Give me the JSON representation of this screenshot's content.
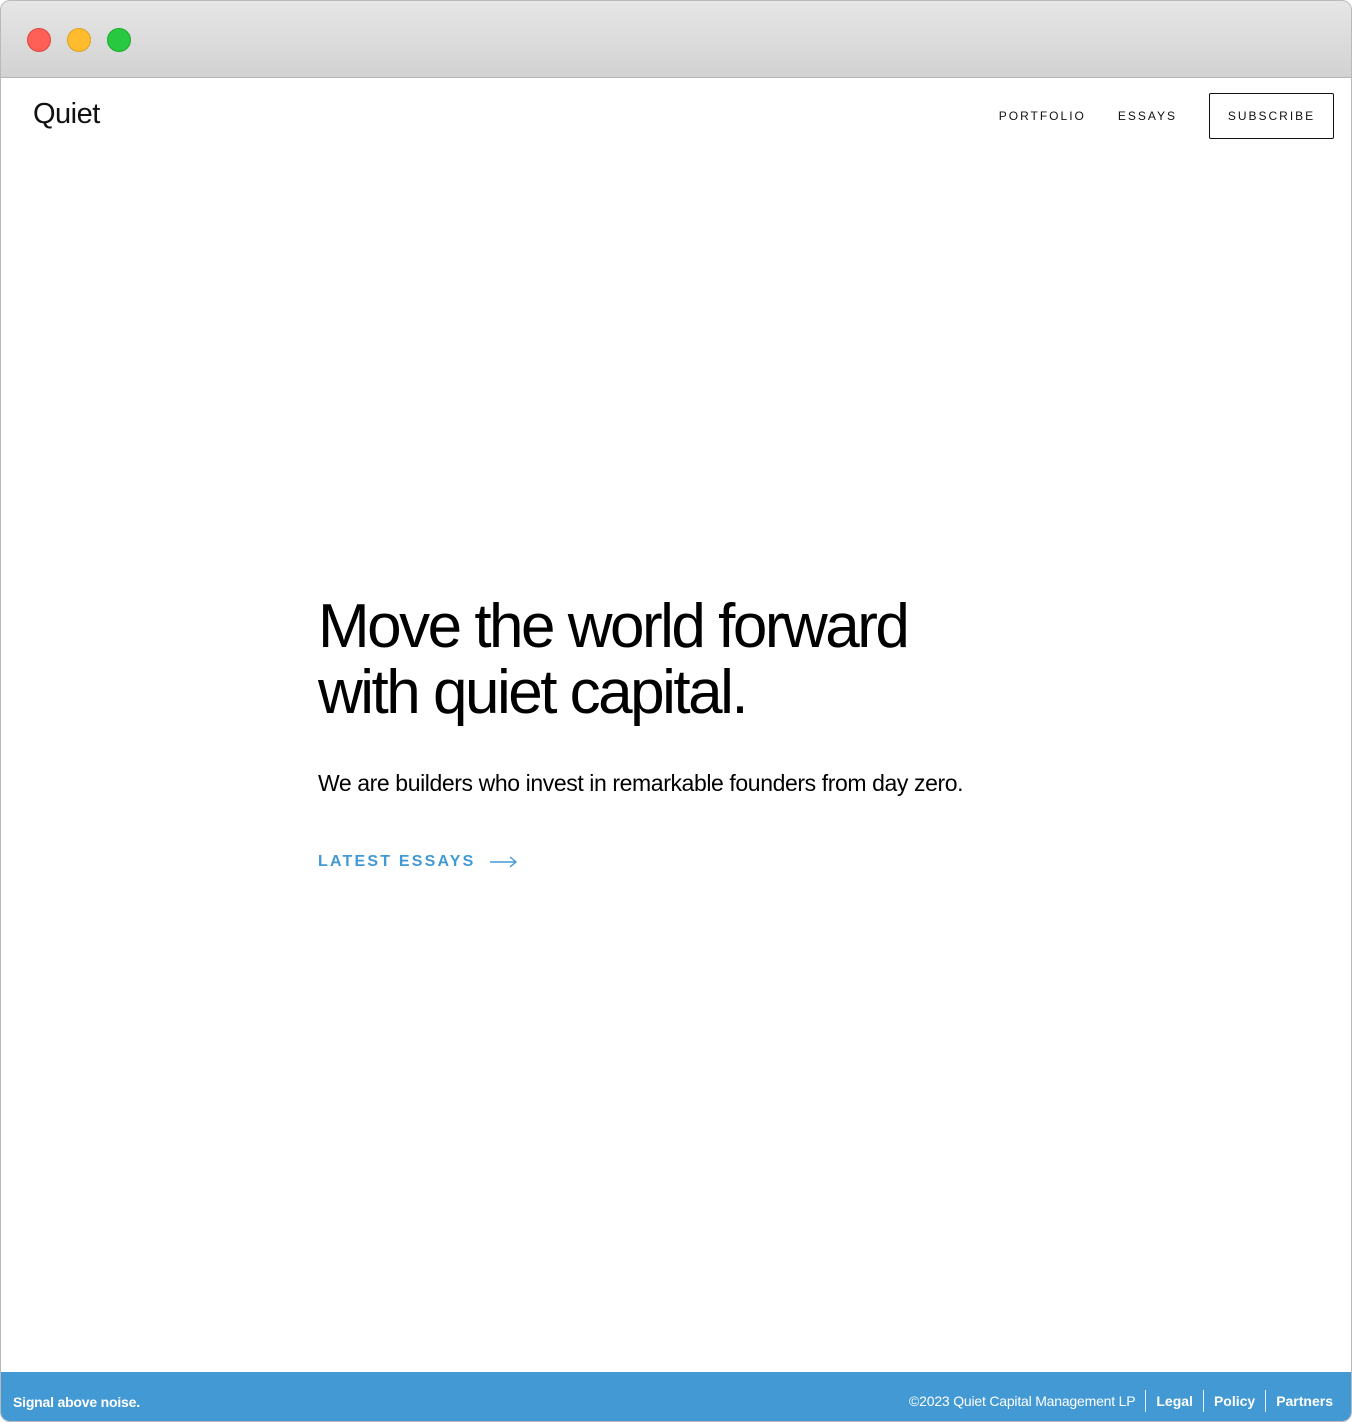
{
  "window": {
    "controls": [
      "close",
      "minimize",
      "maximize"
    ]
  },
  "header": {
    "logo": "Quiet",
    "nav": [
      {
        "label": "PORTFOLIO"
      },
      {
        "label": "ESSAYS"
      }
    ],
    "subscribe_label": "SUBSCRIBE"
  },
  "hero": {
    "headline_line1": "Move the world forward",
    "headline_line2": "with quiet capital.",
    "subtitle": "We are builders who invest in remarkable founders from day zero.",
    "cta_label": "LATEST ESSAYS",
    "cta_icon": "arrow-right-icon"
  },
  "footer": {
    "tagline": "Signal above noise.",
    "copyright": "©2023 Quiet Capital Management LP",
    "links": [
      {
        "label": "Legal"
      },
      {
        "label": "Policy"
      },
      {
        "label": "Partners"
      }
    ]
  },
  "colors": {
    "accent": "#4399d3",
    "text": "#000000",
    "background": "#ffffff"
  }
}
